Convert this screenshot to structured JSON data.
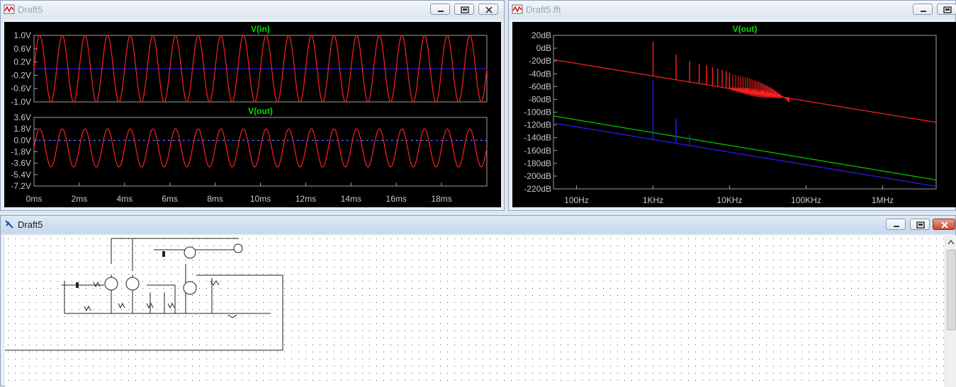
{
  "windows": {
    "transient": {
      "title": "Draft5",
      "plots": [
        {
          "trace": "V(in)",
          "yticks": [
            "1.0V",
            "0.6V",
            "0.2V",
            "-0.2V",
            "-0.6V",
            "-1.0V"
          ]
        },
        {
          "trace": "V(out)",
          "yticks": [
            "3.6V",
            "1.8V",
            "0.0V",
            "-1.8V",
            "-3.6V",
            "-5.4V",
            "-7.2V"
          ]
        }
      ],
      "xticks": [
        "0ms",
        "2ms",
        "4ms",
        "6ms",
        "8ms",
        "10ms",
        "12ms",
        "14ms",
        "16ms",
        "18ms"
      ]
    },
    "fft": {
      "title": "Draft5.fft",
      "trace": "V(out)",
      "yticks": [
        "20dB",
        "0dB",
        "-20dB",
        "-40dB",
        "-60dB",
        "-80dB",
        "-100dB",
        "-120dB",
        "-140dB",
        "-160dB",
        "-180dB",
        "-200dB",
        "-220dB"
      ],
      "xticks": [
        "100Hz",
        "1KHz",
        "10KHz",
        "100KHz",
        "1MHz"
      ]
    },
    "schematic": {
      "title": "Draft5"
    }
  },
  "chart_data": [
    {
      "type": "line",
      "title": "",
      "series": [
        {
          "name": "V(in)",
          "signal": "sine",
          "frequency_hz": 1000,
          "amplitude_v": 1.0
        }
      ],
      "xlabel": "",
      "ylabel": "",
      "xlim": [
        0,
        20
      ],
      "x_unit": "ms",
      "ylim": [
        -1.0,
        1.0
      ],
      "y_unit": "V",
      "grid": false
    },
    {
      "type": "line",
      "title": "",
      "series": [
        {
          "name": "V(out)",
          "signal": "sine",
          "frequency_hz": 1000,
          "amplitude_v": 3.0,
          "offset_v": -1.2
        }
      ],
      "xlim": [
        0,
        20
      ],
      "x_unit": "ms",
      "ylim": [
        -7.2,
        3.6
      ],
      "y_unit": "V",
      "grid": false
    },
    {
      "type": "line",
      "title": "",
      "x_scale": "log",
      "xlim": [
        50,
        5000000
      ],
      "x_unit": "Hz",
      "ylim": [
        -220,
        20
      ],
      "y_unit": "dB",
      "series": [
        {
          "name": "V(out)",
          "color": "#ff2020",
          "floor": [
            [
              50,
              -18
            ],
            [
              5000000,
              -116
            ]
          ],
          "peaks": [
            [
              1000,
              10
            ],
            [
              2000,
              -10
            ],
            [
              3000,
              -20
            ],
            [
              4000,
              -25
            ],
            [
              5000,
              -27
            ],
            [
              6000,
              -30
            ],
            [
              7000,
              -32
            ],
            [
              8000,
              -34
            ],
            [
              9000,
              -36
            ],
            [
              10000,
              -38
            ]
          ]
        },
        {
          "name": "green",
          "color": "#00d000",
          "floor": [
            [
              50,
              -106
            ],
            [
              5000000,
              -206
            ]
          ],
          "peaks": []
        },
        {
          "name": "blue",
          "color": "#2020ff",
          "floor": [
            [
              50,
              -117
            ],
            [
              5000000,
              -216
            ]
          ],
          "peaks": [
            [
              1000,
              -50
            ],
            [
              2000,
              -110
            ],
            [
              3000,
              -135
            ]
          ]
        }
      ]
    }
  ],
  "colors": {
    "trace_red": "#ff2020",
    "trace_blue": "#2020ff",
    "trace_green": "#00d000",
    "title_green": "#00e000"
  }
}
